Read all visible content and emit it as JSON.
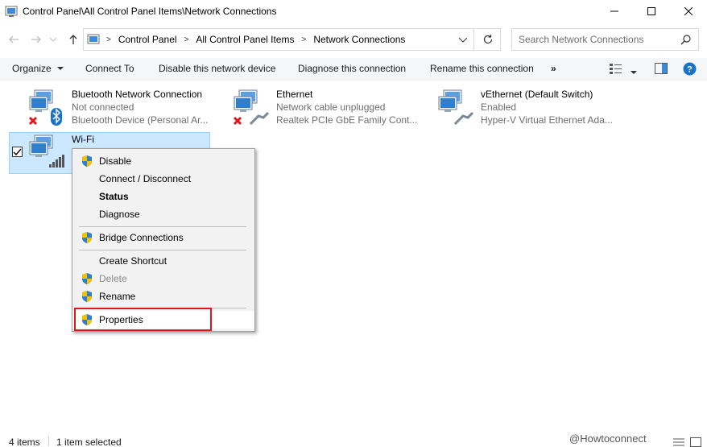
{
  "window": {
    "title": "Control Panel\\All Control Panel Items\\Network Connections"
  },
  "address": {
    "crumbs": [
      "Control Panel",
      "All Control Panel Items",
      "Network Connections"
    ],
    "search_placeholder": "Search Network Connections"
  },
  "commands": {
    "organize": "Organize",
    "connect_to": "Connect To",
    "disable": "Disable this network device",
    "diagnose": "Diagnose this connection",
    "rename": "Rename this connection",
    "more": "»"
  },
  "items": [
    {
      "name": "Bluetooth Network Connection",
      "status": "Not connected",
      "device": "Bluetooth Device (Personal Ar..."
    },
    {
      "name": "Ethernet",
      "status": "Network cable unplugged",
      "device": "Realtek PCIe GbE Family Cont..."
    },
    {
      "name": "vEthernet (Default Switch)",
      "status": "Enabled",
      "device": "Hyper-V Virtual Ethernet Ada..."
    },
    {
      "name": "Wi-Fi"
    }
  ],
  "context_menu": {
    "disable": "Disable",
    "connect_disconnect": "Connect / Disconnect",
    "status": "Status",
    "diagnose": "Diagnose",
    "bridge": "Bridge Connections",
    "create_shortcut": "Create Shortcut",
    "delete": "Delete",
    "rename": "Rename",
    "properties": "Properties"
  },
  "status_bar": {
    "count": "4 items",
    "selected": "1 item selected"
  },
  "watermark": "@Howtoconnect",
  "colors": {
    "selection": "#cce8ff",
    "highlight_box": "#e0161d",
    "help_icon": "#1a73c9"
  }
}
